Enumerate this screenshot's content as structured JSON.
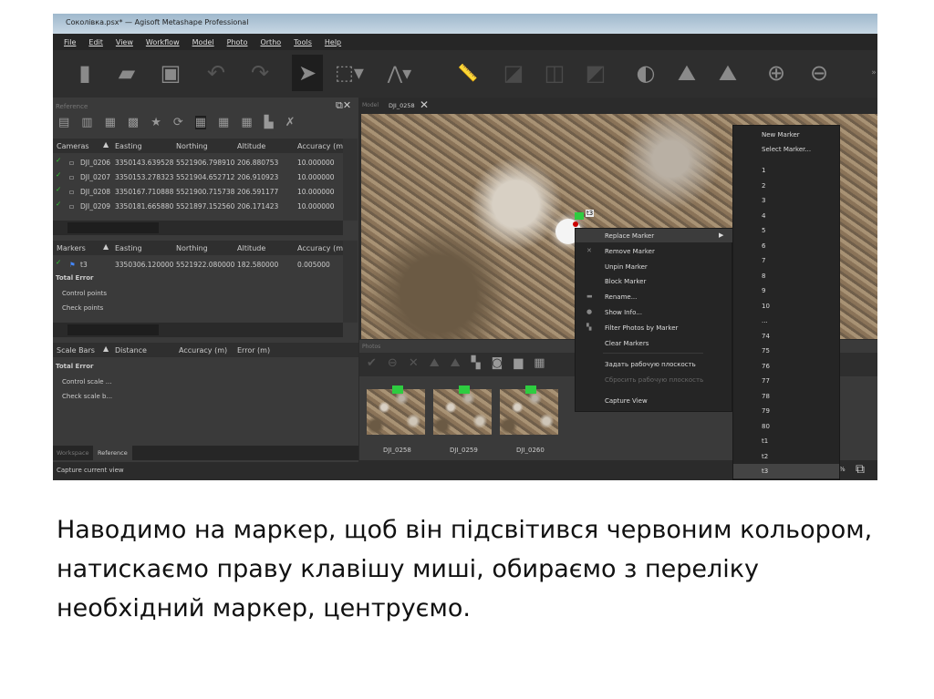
{
  "window": {
    "title": "Соколівка.psx* — Agisoft Metashape Professional"
  },
  "menu": [
    "File",
    "Edit",
    "View",
    "Workflow",
    "Model",
    "Photo",
    "Ortho",
    "Tools",
    "Help"
  ],
  "reference": {
    "panel_title": "Reference",
    "cameras": {
      "headers": [
        "Cameras",
        "Easting",
        "Northing",
        "Altitude",
        "Accuracy (m"
      ],
      "rows": [
        [
          "DJI_0206",
          "3350143.639528",
          "5521906.798910",
          "206.880753",
          "10.000000"
        ],
        [
          "DJI_0207",
          "3350153.278323",
          "5521904.652712",
          "206.910923",
          "10.000000"
        ],
        [
          "DJI_0208",
          "3350167.710888",
          "5521900.715738",
          "206.591177",
          "10.000000"
        ],
        [
          "DJI_0209",
          "3350181.665880",
          "5521897.152560",
          "206.171423",
          "10.000000"
        ]
      ]
    },
    "markers": {
      "headers": [
        "Markers",
        "Easting",
        "Northing",
        "Altitude",
        "Accuracy (m"
      ],
      "rows": [
        [
          "t3",
          "3350306.120000",
          "5521922.080000",
          "182.580000",
          "0.005000"
        ]
      ],
      "total_error": "Total Error",
      "control": "Control points",
      "check": "Check points"
    },
    "scalebars": {
      "headers": [
        "Scale Bars",
        "Distance",
        "Accuracy (m)",
        "Error (m)"
      ],
      "total_error": "Total Error",
      "control": "Control scale ...",
      "check": "Check scale b..."
    },
    "tabs": [
      "Workspace",
      "Reference"
    ]
  },
  "status": "Capture current view",
  "view_tabs": [
    "Model",
    "DJI_0258"
  ],
  "marker_label": "t3",
  "photos": {
    "title": "Photos",
    "items": [
      "DJI_0258",
      "DJI_0259",
      "DJI_0260"
    ],
    "zoom_partial": "%"
  },
  "context_menu": [
    "Replace Marker",
    "Remove Marker",
    "Unpin Marker",
    "Block Marker",
    "Rename...",
    "Show Info...",
    "Filter Photos by Marker",
    "Clear Markers",
    "Задать рабочую плоскость",
    "Сбросить рабочую плоскость",
    "Capture View"
  ],
  "submenu": {
    "top": [
      "New Marker",
      "Select Marker..."
    ],
    "items": [
      "1",
      "2",
      "3",
      "4",
      "5",
      "6",
      "7",
      "8",
      "9",
      "10",
      "...",
      "74",
      "75",
      "76",
      "77",
      "78",
      "79",
      "80",
      "t1",
      "t2",
      "t3"
    ]
  },
  "caption": "Наводимо на маркер,  щоб він підсвітився червоним кольором, натискаємо праву клавішу миші, обираємо з переліку необхідний маркер, центруємо."
}
